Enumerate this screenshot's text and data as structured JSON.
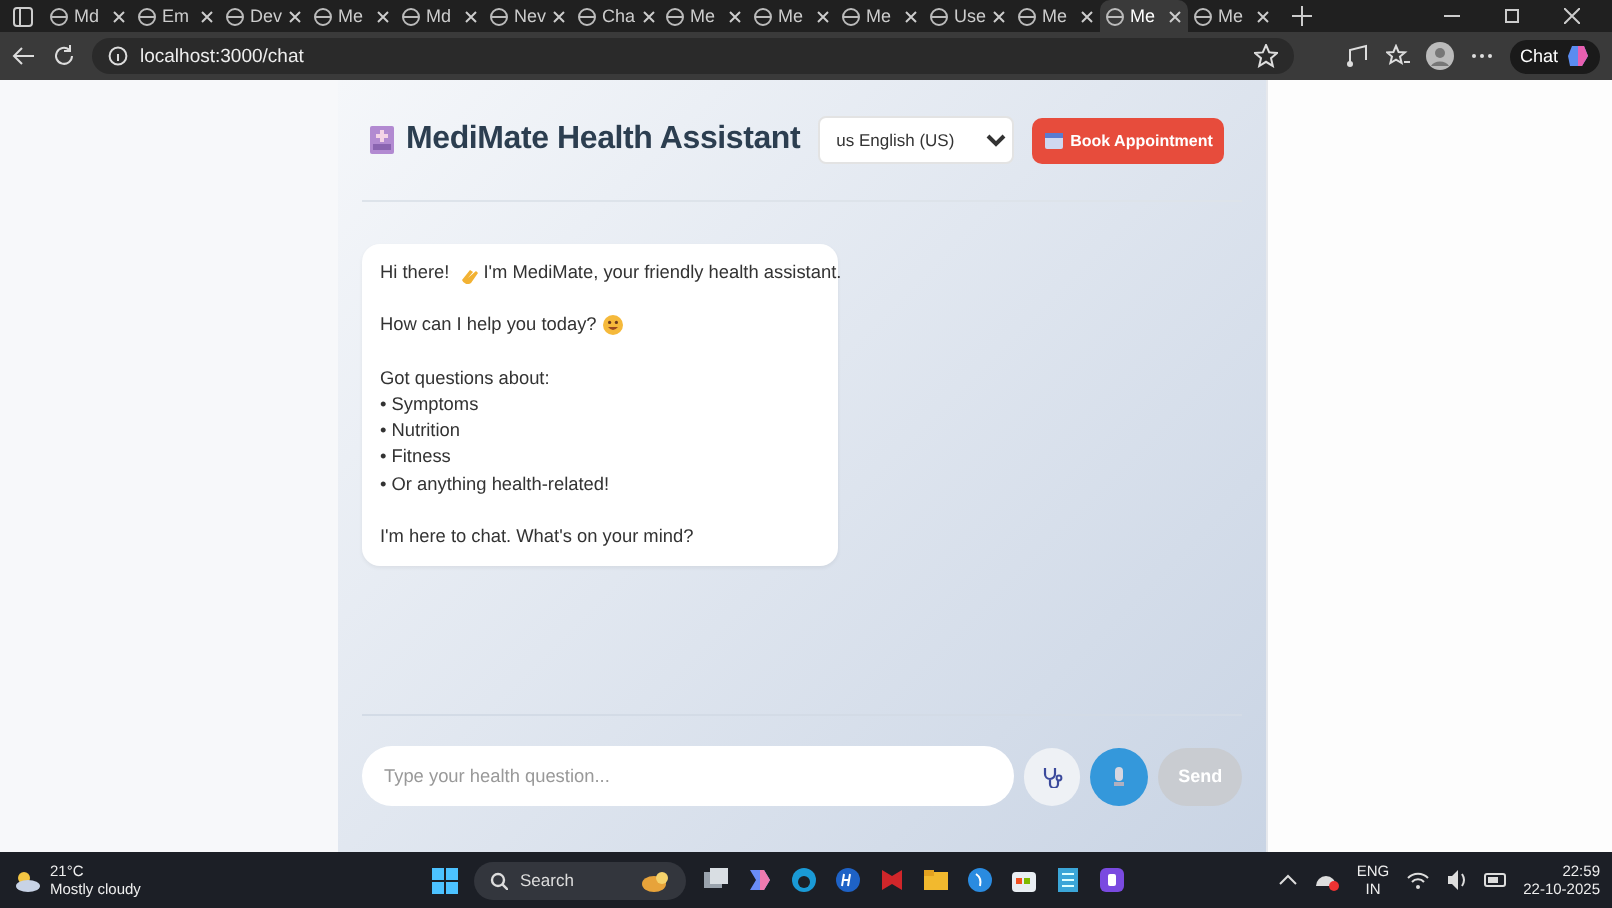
{
  "browser": {
    "tabs": [
      {
        "label": "Md",
        "selected": false
      },
      {
        "label": "Em",
        "selected": false
      },
      {
        "label": "Dev",
        "selected": false
      },
      {
        "label": "Me",
        "selected": false
      },
      {
        "label": "Md",
        "selected": false
      },
      {
        "label": "Nev",
        "selected": false
      },
      {
        "label": "Cha",
        "selected": false
      },
      {
        "label": "Me",
        "selected": false
      },
      {
        "label": "Me",
        "selected": false
      },
      {
        "label": "Me",
        "selected": false
      },
      {
        "label": "Use",
        "selected": false
      },
      {
        "label": "Me",
        "selected": false
      },
      {
        "label": "Me",
        "selected": true
      },
      {
        "label": "Me",
        "selected": false
      }
    ],
    "address": "localhost:3000/chat",
    "chat_button": "Chat"
  },
  "app": {
    "title": "MediMate Health Assistant",
    "language": "us English (US)",
    "book_button": "Book Appointment",
    "message": [
      {
        "kind": "greeting",
        "text": "Hi there!",
        "rest": "I'm MediMate, your friendly health assistant."
      },
      {
        "kind": "question",
        "text": "How can I help you today?"
      },
      {
        "kind": "list",
        "lines": [
          "Got questions about:",
          "• Symptoms",
          "• Nutrition",
          "• Fitness",
          "• Or anything health-related!"
        ]
      },
      {
        "kind": "closing",
        "text": "I'm here to chat. What's on your mind?"
      }
    ],
    "input": {
      "placeholder": "Type your health question..."
    },
    "send_button": "Send",
    "send_disabled": true
  },
  "taskbar": {
    "temperature": "21°C",
    "weather": "Mostly cloudy",
    "search": "Search",
    "language": "ENG",
    "region": "IN",
    "time": "22:59",
    "date": "22-10-2025"
  }
}
